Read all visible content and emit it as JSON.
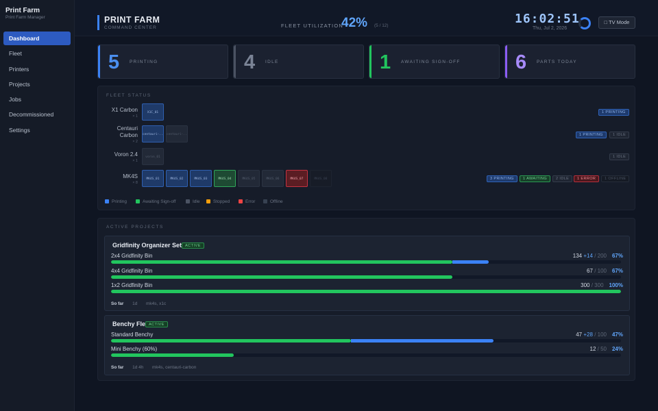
{
  "sidebar": {
    "title": "Print Farm",
    "subtitle": "Print Farm Manager",
    "items": [
      {
        "label": "Dashboard",
        "active": true
      },
      {
        "label": "Fleet"
      },
      {
        "label": "Printers"
      },
      {
        "label": "Projects"
      },
      {
        "label": "Jobs"
      },
      {
        "label": "Decommissioned"
      },
      {
        "label": "Settings"
      }
    ]
  },
  "header": {
    "title": "PRINT FARM",
    "subtitle": "COMMAND CENTER",
    "utilization_label": "FLEET UTILIZATION",
    "utilization_value": "42%",
    "utilization_fraction": "(5 / 12)",
    "utilization_percent": 42,
    "clock": "16:02:51",
    "date": "Thu, Jul 2, 2026",
    "tv_mode_label": "□ TV Mode"
  },
  "kpis": [
    {
      "value": "5",
      "label": "PRINTING",
      "color": "#4b8ff0"
    },
    {
      "value": "4",
      "label": "IDLE",
      "color": "#7a8395"
    },
    {
      "value": "1",
      "label": "AWAITING SIGN-OFF",
      "color": "#22c55e"
    },
    {
      "value": "6",
      "label": "PARTS TODAY",
      "color": "#a78bfa"
    }
  ],
  "fleet_status": {
    "title": "FLEET STATUS",
    "groups": [
      {
        "name": "X1 Carbon",
        "count": "× 1",
        "printers": [
          {
            "id": "X1C_01",
            "state": "printing"
          }
        ],
        "badges": [
          {
            "text": "1 PRINTING",
            "state": "printing"
          }
        ]
      },
      {
        "name": "Centauri Carbon",
        "count": "× 2",
        "printers": [
          {
            "id": "centauri-...",
            "state": "printing"
          },
          {
            "id": "centauri-...",
            "state": "idle"
          }
        ],
        "badges": [
          {
            "text": "1 PRINTING",
            "state": "printing"
          },
          {
            "text": "1 IDLE",
            "state": "idle"
          }
        ]
      },
      {
        "name": "Voron 2.4",
        "count": "× 1",
        "printers": [
          {
            "id": "voron_01",
            "state": "idle"
          }
        ],
        "badges": [
          {
            "text": "1 IDLE",
            "state": "idle"
          }
        ]
      },
      {
        "name": "MK4S",
        "count": "× 8",
        "printers": [
          {
            "id": "MK4S_01",
            "state": "printing"
          },
          {
            "id": "MK4S_02",
            "state": "printing"
          },
          {
            "id": "MK4S_03",
            "state": "printing"
          },
          {
            "id": "MK4S_04",
            "state": "awaiting"
          },
          {
            "id": "MK4S_05",
            "state": "idle"
          },
          {
            "id": "MK4S_06",
            "state": "idle"
          },
          {
            "id": "MK4S_07",
            "state": "error"
          },
          {
            "id": "MK4S_08",
            "state": "offline"
          }
        ],
        "badges": [
          {
            "text": "3 PRINTING",
            "state": "printing"
          },
          {
            "text": "1 AWAITING",
            "state": "awaiting"
          },
          {
            "text": "2 IDLE",
            "state": "idle"
          },
          {
            "text": "1 ERROR",
            "state": "error"
          },
          {
            "text": "1 OFFLINE",
            "state": "offline"
          }
        ]
      }
    ],
    "legend": [
      {
        "label": "Printing",
        "color": "#3b82f6"
      },
      {
        "label": "Awaiting Sign-off",
        "color": "#22c55e"
      },
      {
        "label": "Idle",
        "color": "#4b5363"
      },
      {
        "label": "Stopped",
        "color": "#f59e0b"
      },
      {
        "label": "Error",
        "color": "#ef4444"
      },
      {
        "label": "Offline",
        "color": "#374151"
      }
    ]
  },
  "projects": {
    "title": "ACTIVE PROJECTS",
    "list": [
      {
        "name": "Gridfinity Organizer Set",
        "status": "ACTIVE",
        "items": [
          {
            "name": "2x4 Gridfinity Bin",
            "done": "134",
            "inprog": "+14",
            "total": "/ 200",
            "pct": "67%",
            "done_frac": 0.67,
            "inprog_frac": 0.07
          },
          {
            "name": "4x4 Gridfinity Bin",
            "done": "67",
            "inprog": "",
            "total": "/ 100",
            "pct": "67%",
            "done_frac": 0.67,
            "inprog_frac": 0
          },
          {
            "name": "1x2 Gridfinity Bin",
            "done": "300",
            "inprog": "",
            "total": "/ 300",
            "pct": "100%",
            "done_frac": 1.0,
            "inprog_frac": 0
          }
        ],
        "footer_label": "So far",
        "footer_time": "1d",
        "footer_printers": "mk4s, x1c"
      },
      {
        "name": "Benchy Fleet",
        "status": "ACTIVE",
        "items": [
          {
            "name": "Standard Benchy",
            "done": "47",
            "inprog": "+28",
            "total": "/ 100",
            "pct": "47%",
            "done_frac": 0.47,
            "inprog_frac": 0.28
          },
          {
            "name": "Mini Benchy (60%)",
            "done": "12",
            "inprog": "",
            "total": "/ 50",
            "pct": "24%",
            "done_frac": 0.24,
            "inprog_frac": 0
          }
        ],
        "footer_label": "So far",
        "footer_time": "1d 4h",
        "footer_printers": "mk4s, centauri-carbon"
      }
    ]
  }
}
